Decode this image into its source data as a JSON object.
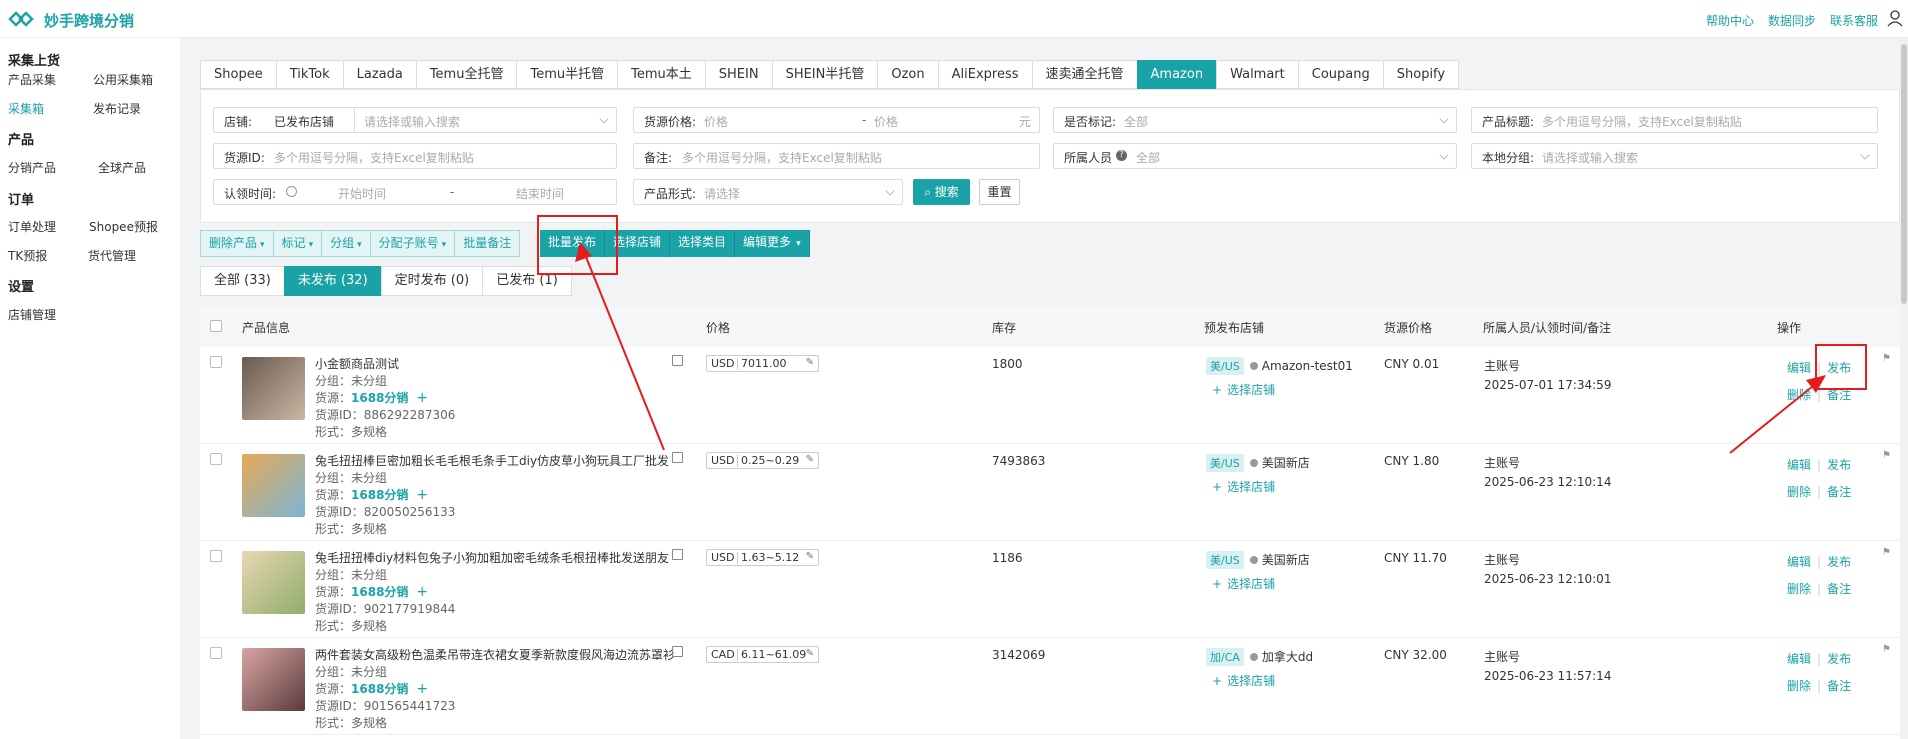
{
  "app": {
    "title": "妙手跨境分销",
    "top_links": [
      "帮助中心",
      "数据同步",
      "联系客服"
    ]
  },
  "sidebar": {
    "sections": [
      {
        "head": "采集上货",
        "items": [
          "产品采集",
          "公用采集箱",
          "采集箱",
          "发布记录"
        ]
      },
      {
        "head": "产品",
        "items": [
          "分销产品",
          "全球产品"
        ]
      },
      {
        "head": "订单",
        "items": [
          "订单处理",
          "Shopee预报",
          "TK预报",
          "货代管理"
        ]
      },
      {
        "head": "设置",
        "items": [
          "店铺管理"
        ]
      }
    ],
    "active": "采集箱"
  },
  "platform_tabs": [
    "Shopee",
    "TikTok",
    "Lazada",
    "Temu全托管",
    "Temu半托管",
    "Temu本土",
    "SHEIN",
    "SHEIN半托管",
    "Ozon",
    "AliExpress",
    "速卖通全托管",
    "Amazon",
    "Walmart",
    "Coupang",
    "Shopify"
  ],
  "active_platform": "Amazon",
  "filters": {
    "store_label": "店铺:",
    "store_value": "已发布店铺",
    "store_search_ph": "请选择或输入搜索",
    "src_price_label": "货源价格:",
    "price_ph": "价格",
    "price_dash": "-",
    "price_unit": "元",
    "marked_label": "是否标记:",
    "marked_value": "全部",
    "title_label": "产品标题:",
    "title_ph": "多个用逗号分隔，支持Excel复制粘贴",
    "srcid_label": "货源ID:",
    "srcid_ph": "多个用逗号分隔，支持Excel复制粘贴",
    "note_label": "备注:",
    "note_ph": "多个用逗号分隔，支持Excel复制粘贴",
    "owner_label": "所属人员",
    "owner_value": "全部",
    "group_label": "本地分组:",
    "group_ph": "请选择或输入搜索",
    "claim_label": "认领时间:",
    "start_ph": "开始时间",
    "end_ph": "结束时间",
    "time_dash": "-",
    "form_label": "产品形式:",
    "form_ph": "请选择",
    "search_btn": "搜索",
    "reset_btn": "重置"
  },
  "actions": {
    "light": [
      "删除产品",
      "标记",
      "分组",
      "分配子账号",
      "批量备注"
    ],
    "dark": [
      "批量发布",
      "选择店铺",
      "选择类目",
      "编辑更多"
    ]
  },
  "status_tabs": [
    "全部 (33)",
    "未发布 (32)",
    "定时发布 (0)",
    "已发布 (1)"
  ],
  "active_status": "未发布 (32)",
  "table": {
    "headers": {
      "info": "产品信息",
      "price": "价格",
      "stock": "库存",
      "store": "预发布店铺",
      "src_price": "货源价格",
      "owner": "所属人员/认领时间/备注",
      "ops": "操作"
    },
    "rows": [
      {
        "title": "小金额商品测试",
        "group": "分组：未分组",
        "src_label": "货源：",
        "src": "1688分销",
        "srcid": "货源ID：886292287306",
        "form": "形式：多规格",
        "cur": "USD",
        "price": "7011.00",
        "stock": "1800",
        "country": "美/US",
        "store": "Amazon-test01",
        "select_store": "选择店铺",
        "src_price": "CNY 0.01",
        "owner": "主账号",
        "time": "2025-07-01 17:34:59",
        "thumb": "#6a5a4e",
        "thumb2": "#c9b8a4"
      },
      {
        "title": "兔毛扭扭棒巨密加粗长毛毛根毛条手工diy仿皮草小狗玩具工厂批发",
        "group": "分组：未分组",
        "src_label": "货源：",
        "src": "1688分销",
        "srcid": "货源ID：820050256133",
        "form": "形式：多规格",
        "cur": "USD",
        "price": "0.25~0.29",
        "stock": "7493863",
        "country": "美/US",
        "store": "美国新店",
        "select_store": "选择店铺",
        "src_price": "CNY 1.80",
        "owner": "主账号",
        "time": "2025-06-23 12:10:14",
        "thumb": "#e8a855",
        "thumb2": "#7ab6d6"
      },
      {
        "title": "兔毛扭扭棒diy材料包兔子小狗加粗加密毛绒条毛根扭棒批发送朋友",
        "group": "分组：未分组",
        "src_label": "货源：",
        "src": "1688分销",
        "srcid": "货源ID：902177919844",
        "form": "形式：多规格",
        "cur": "USD",
        "price": "1.63~5.12",
        "stock": "1186",
        "country": "美/US",
        "store": "美国新店",
        "select_store": "选择店铺",
        "src_price": "CNY 11.70",
        "owner": "主账号",
        "time": "2025-06-23 12:10:01",
        "thumb": "#e9d6b5",
        "thumb2": "#8fae6a"
      },
      {
        "title": "两件套装女高级粉色温柔吊带连衣裙女夏季新款度假风海边流苏罩衫",
        "group": "分组：未分组",
        "src_label": "货源：",
        "src": "1688分销",
        "srcid": "货源ID：901565441723",
        "form": "形式：多规格",
        "cur": "CAD",
        "price": "6.11~61.09",
        "stock": "3142069",
        "country": "加/CA",
        "store": "加拿大dd",
        "select_store": "选择店铺",
        "src_price": "CNY 32.00",
        "owner": "主账号",
        "time": "2025-06-23 11:57:14",
        "thumb": "#d9a4a4",
        "thumb2": "#5a3b3b"
      }
    ],
    "ops": {
      "edit": "编辑",
      "publish": "发布",
      "delete": "删除",
      "note": "备注"
    }
  }
}
